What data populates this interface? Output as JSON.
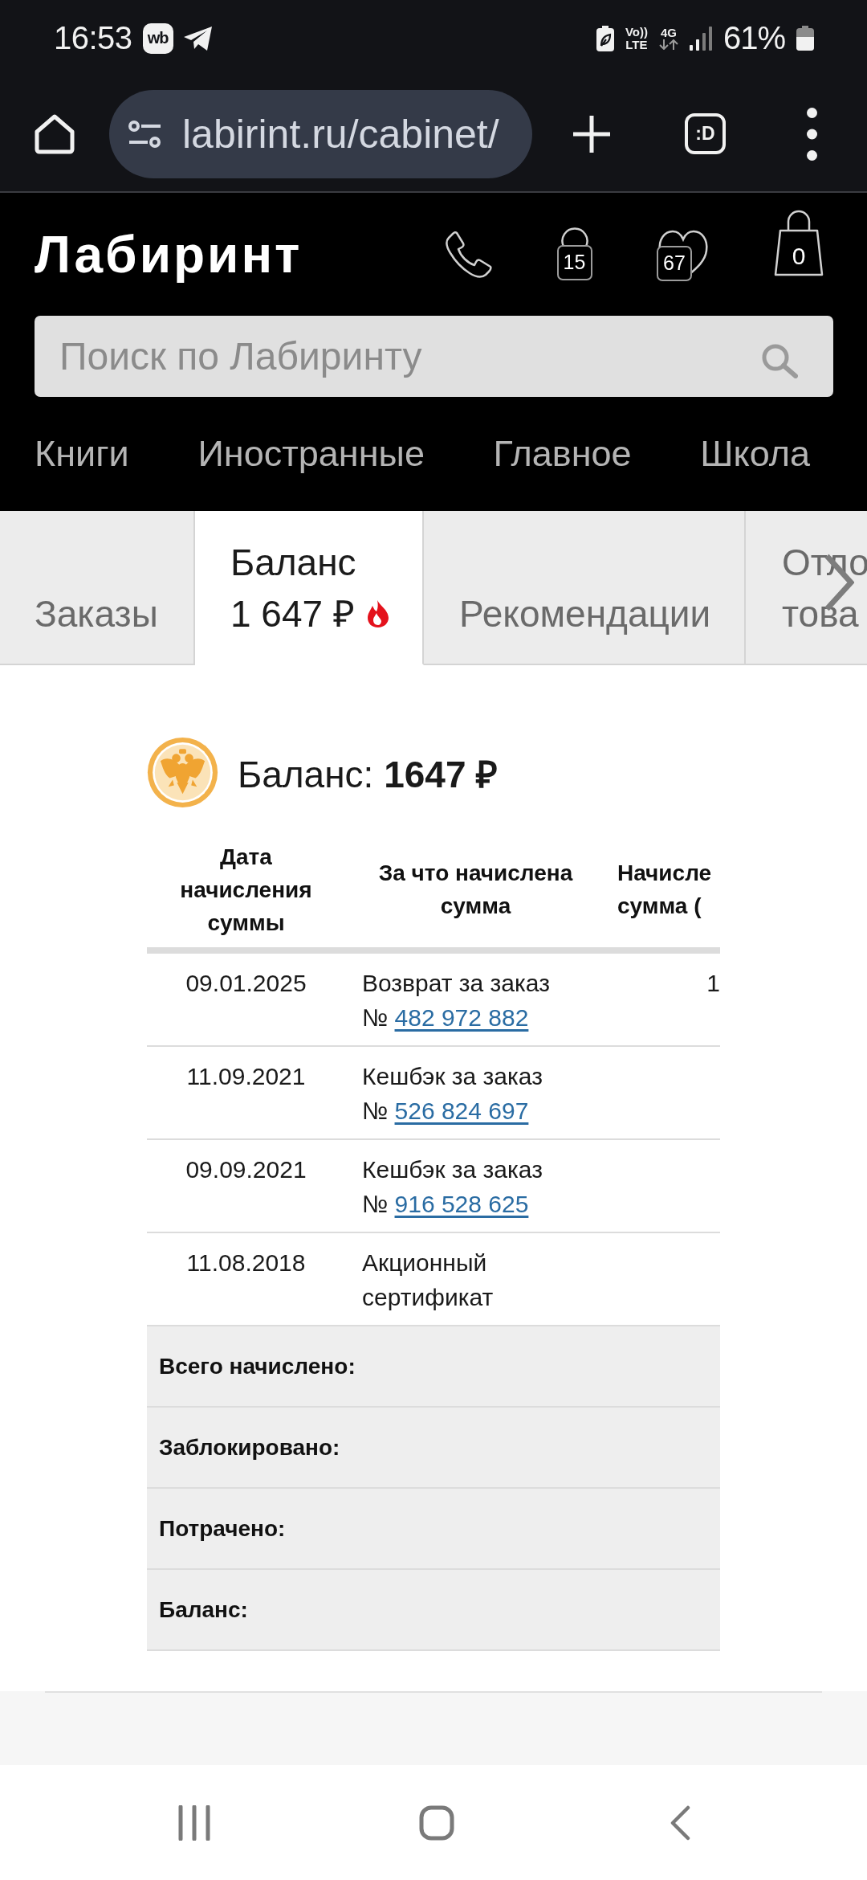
{
  "status_bar": {
    "time": "16:53",
    "notifications": [
      {
        "kind": "app_badge",
        "label": "wb"
      },
      {
        "kind": "telegram"
      }
    ],
    "volte": [
      "Vo))",
      "LTE"
    ],
    "network": "4G",
    "battery": "61%"
  },
  "browser_bar": {
    "url": "labirint.ru/cabinet/",
    "tab_switcher": ":D"
  },
  "site_header": {
    "logo": "Лабиринт",
    "actions": [
      {
        "kind": "phone"
      },
      {
        "kind": "profile",
        "count": "15"
      },
      {
        "kind": "favorites",
        "count": "67"
      },
      {
        "kind": "cart",
        "count": "0"
      }
    ],
    "search": {
      "placeholder": "Поиск по Лабиринту"
    },
    "nav": [
      "Книги",
      "Иностранные",
      "Главное",
      "Школа"
    ]
  },
  "tabs": [
    {
      "lines": [
        "Заказы"
      ],
      "flame": false,
      "selected": false
    },
    {
      "lines": [
        "Баланс",
        "1 647 ₽"
      ],
      "flame": true,
      "selected": true
    },
    {
      "lines": [
        "Рекомендации"
      ],
      "flame": false,
      "selected": false
    },
    {
      "lines": [
        "Отло",
        "това"
      ],
      "flame": false,
      "selected": false
    }
  ],
  "balance": {
    "label": "Баланс:",
    "amount": "1647 ₽"
  },
  "table": {
    "columns": [
      "Дата начисления суммы",
      "За что начислена сумма",
      "Начисле сумма ("
    ],
    "rows": [
      {
        "date": "09.01.2025",
        "description": "Возврат за заказ",
        "order_sign": "№",
        "order": "482 972 882",
        "amount": "1"
      },
      {
        "date": "11.09.2021",
        "description": "Кешбэк за заказ",
        "order_sign": "№",
        "order": "526 824 697"
      },
      {
        "date": "09.09.2021",
        "description": "Кешбэк за заказ",
        "order_sign": "№",
        "order": "916 528 625"
      },
      {
        "date": "11.08.2018",
        "description": "Акционный сертификат"
      }
    ],
    "totals": [
      "Всего начислено:",
      "Заблокировано:",
      "Потрачено:",
      "Баланс:"
    ]
  }
}
